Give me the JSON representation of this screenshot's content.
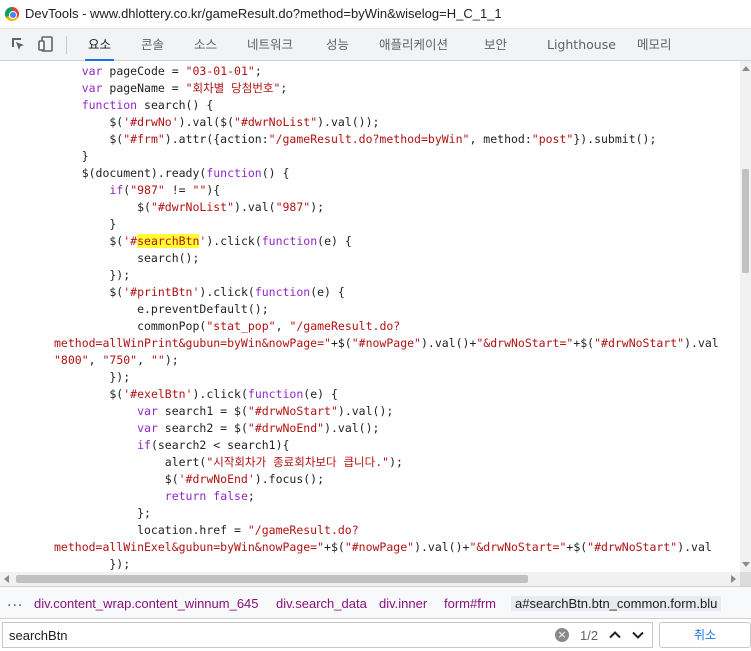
{
  "window": {
    "title": "DevTools - www.dhlottery.co.kr/gameResult.do?method=byWin&wiselog=H_C_1_1"
  },
  "toolbar": {
    "inspect_icon": "inspect-element-icon",
    "device_icon": "device-toggle-icon",
    "tabs": [
      {
        "label": "요소",
        "active": true
      },
      {
        "label": "콘솔"
      },
      {
        "label": "소스"
      },
      {
        "label": "네트워크"
      },
      {
        "label": "성능"
      },
      {
        "label": "애플리케이션"
      },
      {
        "label": "보안"
      },
      {
        "label": "Lighthouse"
      },
      {
        "label": "메모리"
      }
    ]
  },
  "code": {
    "lines": [
      [
        {
          "t": "    "
        },
        {
          "t": "var",
          "c": "kw"
        },
        {
          "t": " pageCode = "
        },
        {
          "t": "\"03-01-01\"",
          "c": "str"
        },
        {
          "t": ";"
        }
      ],
      [
        {
          "t": "    "
        },
        {
          "t": "var",
          "c": "kw"
        },
        {
          "t": " pageName = "
        },
        {
          "t": "\"회차별 당첨번호\"",
          "c": "str"
        },
        {
          "t": ";"
        }
      ],
      [
        {
          "t": "    "
        },
        {
          "t": "function",
          "c": "kw"
        },
        {
          "t": " search() {"
        }
      ],
      [
        {
          "t": "        $("
        },
        {
          "t": "'#drwNo'",
          "c": "str"
        },
        {
          "t": ").val($("
        },
        {
          "t": "\"#dwrNoList\"",
          "c": "str"
        },
        {
          "t": ").val());"
        }
      ],
      [
        {
          "t": "        $("
        },
        {
          "t": "\"#frm\"",
          "c": "str"
        },
        {
          "t": ").attr({action:"
        },
        {
          "t": "\"/gameResult.do?method=byWin\"",
          "c": "str"
        },
        {
          "t": ", method:"
        },
        {
          "t": "\"post\"",
          "c": "str"
        },
        {
          "t": "}).submit();"
        }
      ],
      [
        {
          "t": "    }"
        }
      ],
      [
        {
          "t": "    $(document).ready("
        },
        {
          "t": "function",
          "c": "kw"
        },
        {
          "t": "() {"
        }
      ],
      [
        {
          "t": "        "
        },
        {
          "t": "if",
          "c": "kw"
        },
        {
          "t": "("
        },
        {
          "t": "\"987\"",
          "c": "str"
        },
        {
          "t": " != "
        },
        {
          "t": "\"\"",
          "c": "str"
        },
        {
          "t": "){"
        }
      ],
      [
        {
          "t": "            $("
        },
        {
          "t": "\"#dwrNoList\"",
          "c": "str"
        },
        {
          "t": ").val("
        },
        {
          "t": "\"987\"",
          "c": "str"
        },
        {
          "t": ");"
        }
      ],
      [
        {
          "t": "        }"
        }
      ],
      [
        {
          "t": "        $("
        },
        {
          "t": "'#",
          "c": "str"
        },
        {
          "t": "searchBtn",
          "c": "str hl"
        },
        {
          "t": "'",
          "c": "str"
        },
        {
          "t": ").click("
        },
        {
          "t": "function",
          "c": "kw"
        },
        {
          "t": "(e) {"
        }
      ],
      [
        {
          "t": "            search();"
        }
      ],
      [
        {
          "t": "        });"
        }
      ],
      [
        {
          "t": "        $("
        },
        {
          "t": "'#printBtn'",
          "c": "str"
        },
        {
          "t": ").click("
        },
        {
          "t": "function",
          "c": "kw"
        },
        {
          "t": "(e) {"
        }
      ],
      [
        {
          "t": "            e.preventDefault();"
        }
      ],
      [
        {
          "t": "            commonPop("
        },
        {
          "t": "\"stat_pop\"",
          "c": "str"
        },
        {
          "t": ", "
        },
        {
          "t": "\"/gameResult.do?",
          "c": "str"
        }
      ],
      [
        {
          "t": "method=allWinPrint&gubun=byWin&nowPage=\"",
          "c": "str"
        },
        {
          "t": "+$("
        },
        {
          "t": "\"#nowPage\"",
          "c": "str"
        },
        {
          "t": ").val()+"
        },
        {
          "t": "\"&drwNoStart=\"",
          "c": "str"
        },
        {
          "t": "+$("
        },
        {
          "t": "\"#drwNoStart\"",
          "c": "str"
        },
        {
          "t": ").val"
        }
      ],
      [
        {
          "t": "\"800\"",
          "c": "str"
        },
        {
          "t": ", "
        },
        {
          "t": "\"750\"",
          "c": "str"
        },
        {
          "t": ", "
        },
        {
          "t": "\"\"",
          "c": "str"
        },
        {
          "t": ");"
        }
      ],
      [
        {
          "t": "        });"
        }
      ],
      [
        {
          "t": "        $("
        },
        {
          "t": "'#exelBtn'",
          "c": "str"
        },
        {
          "t": ").click("
        },
        {
          "t": "function",
          "c": "kw"
        },
        {
          "t": "(e) {"
        }
      ],
      [
        {
          "t": "            "
        },
        {
          "t": "var",
          "c": "kw"
        },
        {
          "t": " search1 = $("
        },
        {
          "t": "\"#drwNoStart\"",
          "c": "str"
        },
        {
          "t": ").val();"
        }
      ],
      [
        {
          "t": "            "
        },
        {
          "t": "var",
          "c": "kw"
        },
        {
          "t": " search2 = $("
        },
        {
          "t": "\"#drwNoEnd\"",
          "c": "str"
        },
        {
          "t": ").val();"
        }
      ],
      [
        {
          "t": "            "
        },
        {
          "t": "if",
          "c": "kw"
        },
        {
          "t": "(search2 < search1){"
        }
      ],
      [
        {
          "t": "                alert("
        },
        {
          "t": "\"시작회차가 종료회차보다 큽니다.\"",
          "c": "str"
        },
        {
          "t": ");"
        }
      ],
      [
        {
          "t": "                $("
        },
        {
          "t": "'#drwNoEnd'",
          "c": "str"
        },
        {
          "t": ").focus();"
        }
      ],
      [
        {
          "t": "                "
        },
        {
          "t": "return",
          "c": "kw"
        },
        {
          "t": " "
        },
        {
          "t": "false",
          "c": "kw"
        },
        {
          "t": ";"
        }
      ],
      [
        {
          "t": "            };"
        }
      ],
      [
        {
          "t": "            location.href = "
        },
        {
          "t": "\"/gameResult.do?",
          "c": "str"
        }
      ],
      [
        {
          "t": "method=allWinExel&gubun=byWin&nowPage=\"",
          "c": "str"
        },
        {
          "t": "+$("
        },
        {
          "t": "\"#nowPage\"",
          "c": "str"
        },
        {
          "t": ").val()+"
        },
        {
          "t": "\"&drwNoStart=\"",
          "c": "str"
        },
        {
          "t": "+$("
        },
        {
          "t": "\"#drwNoStart\"",
          "c": "str"
        },
        {
          "t": ").val"
        }
      ],
      [
        {
          "t": "        });"
        }
      ]
    ]
  },
  "breadcrumbs": {
    "overflow": "...",
    "items": [
      "div.content_wrap.content_winnum_645",
      "div.search_data",
      "div.inner",
      "form#frm",
      "a#searchBtn.btn_common.form.blu"
    ]
  },
  "search": {
    "value": "searchBtn",
    "match_count": "1/2",
    "cancel_label": "취소"
  },
  "colors": {
    "keyword": "#9227c9",
    "string": "#b21212",
    "highlight": "#ffff33",
    "active_tab_underline": "#1a73e8",
    "breadcrumb": "#881280"
  }
}
